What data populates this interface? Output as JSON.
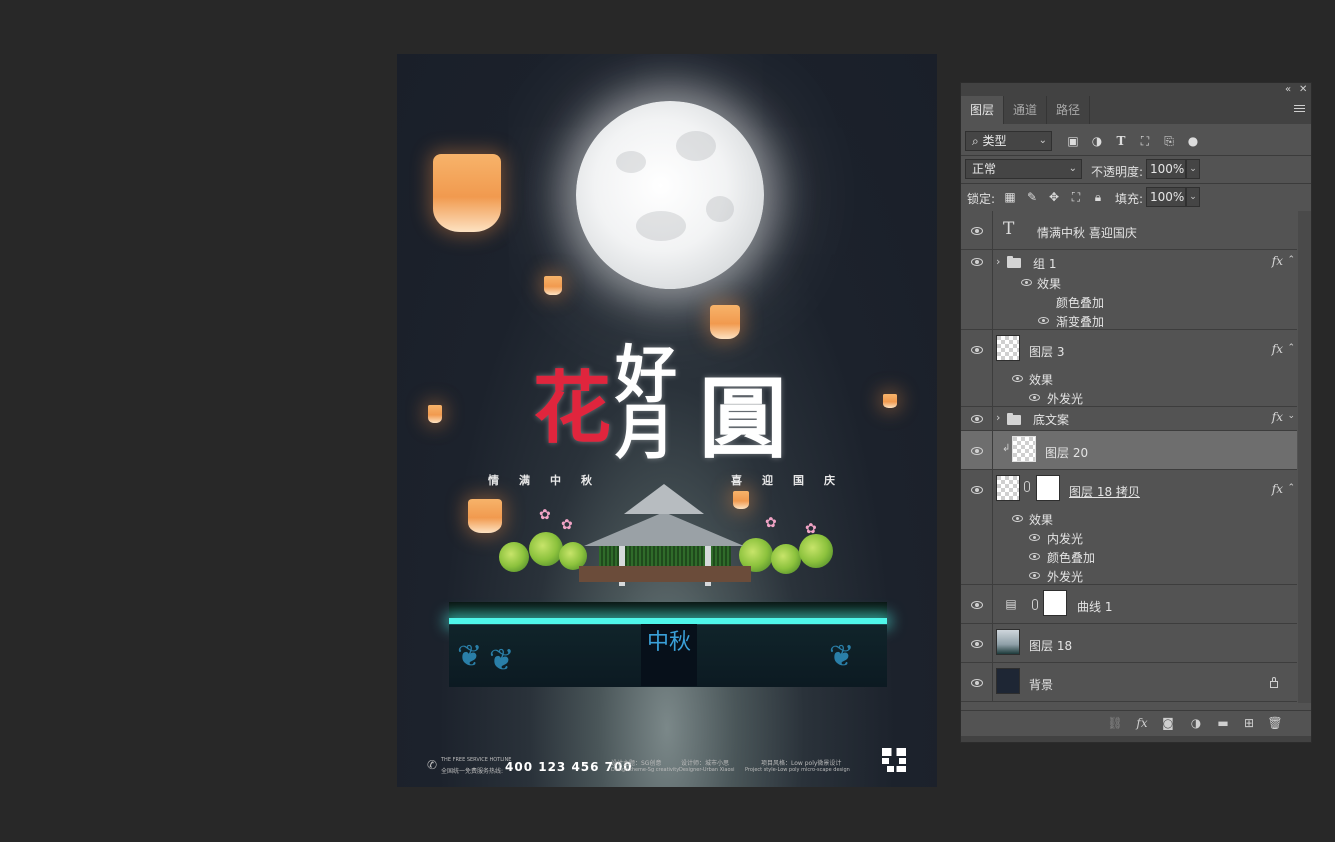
{
  "poster": {
    "title_chars": [
      "花",
      "好",
      "月",
      "圓"
    ],
    "subtitle_left": "情满中秋",
    "subtitle_right": "喜迎国庆",
    "box_label": "中秋",
    "footer": {
      "hotline_label_en": "THE FREE SERVICE HOTLINE",
      "hotline_label": "全国统一免费服务热线:",
      "phone": "400 123 456 700",
      "design_theme": "设计主题：SG创意",
      "design_theme_en": "Design theme-Sg creativity",
      "designer": "设计师：城市小思",
      "designer_en": "Designer-Urban Xiaosi",
      "project_style": "项目风格：Low poly微景设计",
      "project_style_en": "Project style-Low poly micro-scape design"
    }
  },
  "panel": {
    "tabs": [
      {
        "label": "图层",
        "active": true
      },
      {
        "label": "通道",
        "active": false
      },
      {
        "label": "路径",
        "active": false
      }
    ],
    "filter": {
      "kind": "类型"
    },
    "blend_mode": "正常",
    "opacity_label": "不透明度:",
    "opacity_value": "100%",
    "lock_label": "锁定:",
    "fill_label": "填充:",
    "fill_value": "100%",
    "layers": {
      "text_layer": "情满中秋  喜迎国庆",
      "group1": "组 1",
      "group1_effects": "效果",
      "group1_fx1": "颜色叠加",
      "group1_fx2": "渐变叠加",
      "layer3": "图层 3",
      "layer3_effects": "效果",
      "layer3_fx1": "外发光",
      "group_base": "底文案",
      "layer20": "图层 20",
      "layer18copy": "图层 18 拷贝",
      "layer18copy_effects": "效果",
      "layer18copy_fx1": "内发光",
      "layer18copy_fx2": "颜色叠加",
      "layer18copy_fx3": "外发光",
      "curves1": "曲线 1",
      "layer18": "图层 18",
      "background": "背景"
    },
    "fx_label": "fx"
  },
  "colors": {
    "app_bg": "#282828",
    "panel_bg": "#535353",
    "selected_row": "#6e6e6e",
    "title_red": "#e0253d",
    "glow_cyan": "#4ff6ea"
  }
}
